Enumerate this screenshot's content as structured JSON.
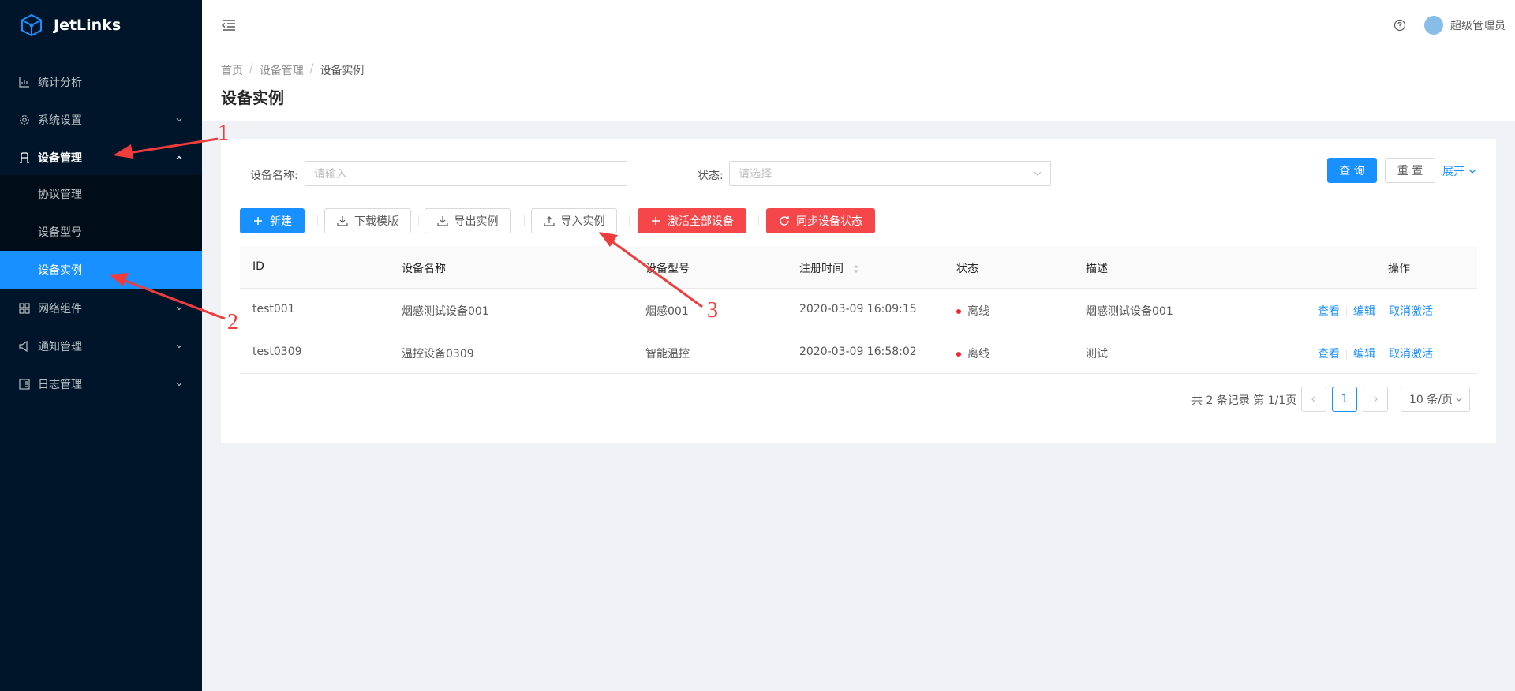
{
  "app": {
    "name": "JetLinks"
  },
  "sidebar": {
    "items": [
      {
        "label": "统计分析",
        "icon": "bar-chart-icon"
      },
      {
        "label": "系统设置",
        "icon": "gear-icon"
      },
      {
        "label": "设备管理",
        "icon": "device-icon",
        "open": true
      },
      {
        "label": "网络组件",
        "icon": "grid-icon"
      },
      {
        "label": "通知管理",
        "icon": "notify-icon"
      },
      {
        "label": "日志管理",
        "icon": "log-icon"
      }
    ],
    "sub_items": [
      {
        "label": "协议管理"
      },
      {
        "label": "设备型号"
      },
      {
        "label": "设备实例",
        "active": true
      }
    ]
  },
  "header": {
    "user_name": "超级管理员"
  },
  "breadcrumb": {
    "home": "首页",
    "parent": "设备管理",
    "current": "设备实例",
    "separator": "/"
  },
  "page": {
    "title": "设备实例"
  },
  "search": {
    "name_label": "设备名称:",
    "name_placeholder": "请输入",
    "status_label": "状态:",
    "status_placeholder": "请选择",
    "query_label": "查 询",
    "reset_label": "重 置",
    "expand_label": "展开"
  },
  "toolbar": {
    "new_label": "新建",
    "download_template_label": "下载模版",
    "export_label": "导出实例",
    "import_label": "导入实例",
    "activate_all_label": "激活全部设备",
    "sync_status_label": "同步设备状态"
  },
  "table": {
    "columns": [
      "ID",
      "设备名称",
      "设备型号",
      "注册时间",
      "状态",
      "描述",
      "操作"
    ],
    "rows": [
      {
        "id": "test001",
        "name": "烟感测试设备001",
        "model": "烟感001",
        "registered": "2020-03-09 16:09:15",
        "status": "离线",
        "desc": "烟感测试设备001",
        "actions": [
          "查看",
          "编辑",
          "取消激活"
        ]
      },
      {
        "id": "test0309",
        "name": "温控设备0309",
        "model": "智能温控",
        "registered": "2020-03-09 16:58:02",
        "status": "离线",
        "desc": "测试",
        "actions": [
          "查看",
          "编辑",
          "取消激活"
        ]
      }
    ]
  },
  "pagination": {
    "total_text": "共 2 条记录 第 1/1页",
    "current_page": "1",
    "page_size": "10 条/页"
  },
  "annotations": [
    "1",
    "2",
    "3"
  ],
  "colors": {
    "sidebar": "#001529",
    "submenu": "#000c17",
    "primary": "#1890ff",
    "danger": "#f5474a",
    "annotation": "#f03c3c"
  }
}
